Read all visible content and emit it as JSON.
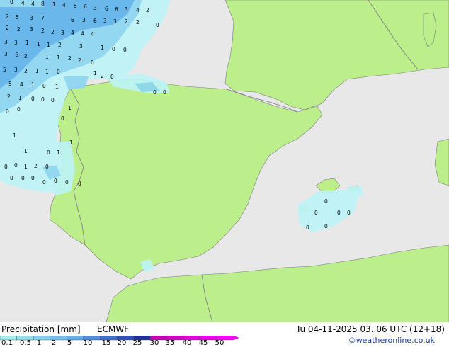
{
  "legend": {
    "title": "Precipitation [mm]",
    "model": "ECMWF",
    "valid": "Tu 04-11-2025 03..06 UTC (12+18)",
    "credit": "©weatheronline.co.uk",
    "ticks": [
      "0.1",
      "0.5",
      "1",
      "2",
      "5",
      "10",
      "15",
      "20",
      "25",
      "30",
      "35",
      "40",
      "45",
      "50"
    ],
    "colors": [
      "#a0f0f0",
      "#90e0f0",
      "#80d0f0",
      "#6fc0f0",
      "#5fb0f0",
      "#4f90e0",
      "#3f70d0",
      "#2f50c0",
      "#1f30a0",
      "#c000c0",
      "#d000d0",
      "#e000e0",
      "#f000f0",
      "#ff00ff"
    ]
  },
  "colors": {
    "sea": "#e8e8e8",
    "land": "#bcee8c",
    "border": "#7a7a7a",
    "precip_light": "#bdf4f8",
    "precip_mid": "#8ad6f2",
    "precip_strong": "#5cb2ec"
  },
  "map_labels": [
    {
      "text": "0"
    },
    {
      "text": "4"
    },
    {
      "text": "4"
    },
    {
      "text": "8"
    },
    {
      "text": "1"
    },
    {
      "text": "4"
    },
    {
      "text": "5"
    },
    {
      "text": "6"
    },
    {
      "text": "3"
    },
    {
      "text": "6"
    },
    {
      "text": "6"
    },
    {
      "text": "3"
    },
    {
      "text": "4"
    },
    {
      "text": "2"
    },
    {
      "text": "2"
    },
    {
      "text": "5"
    },
    {
      "text": "3"
    },
    {
      "text": "7"
    },
    {
      "text": "6"
    },
    {
      "text": "3"
    },
    {
      "text": "6"
    },
    {
      "text": "3"
    },
    {
      "text": "3"
    },
    {
      "text": "2"
    },
    {
      "text": "2"
    },
    {
      "text": "0"
    },
    {
      "text": "2"
    },
    {
      "text": "2"
    },
    {
      "text": "3"
    },
    {
      "text": "2"
    },
    {
      "text": "2"
    },
    {
      "text": "3"
    },
    {
      "text": "4"
    },
    {
      "text": "4"
    },
    {
      "text": "4"
    },
    {
      "text": "3"
    },
    {
      "text": "3"
    },
    {
      "text": "1"
    },
    {
      "text": "1"
    },
    {
      "text": "1"
    },
    {
      "text": "2"
    },
    {
      "text": "3"
    },
    {
      "text": "1"
    },
    {
      "text": "0"
    },
    {
      "text": "0"
    },
    {
      "text": "3"
    },
    {
      "text": "3"
    },
    {
      "text": "2"
    },
    {
      "text": "1"
    },
    {
      "text": "1"
    },
    {
      "text": "2"
    },
    {
      "text": "2"
    },
    {
      "text": "0"
    },
    {
      "text": "5"
    },
    {
      "text": "3"
    },
    {
      "text": "2"
    },
    {
      "text": "1"
    },
    {
      "text": "1"
    },
    {
      "text": "0"
    },
    {
      "text": "1"
    },
    {
      "text": "2"
    },
    {
      "text": "0"
    },
    {
      "text": "5"
    },
    {
      "text": "4"
    },
    {
      "text": "1"
    },
    {
      "text": "0"
    },
    {
      "text": "1"
    },
    {
      "text": "0"
    },
    {
      "text": "0"
    },
    {
      "text": "2"
    },
    {
      "text": "1"
    },
    {
      "text": "0"
    },
    {
      "text": "0"
    },
    {
      "text": "0"
    },
    {
      "text": "0"
    },
    {
      "text": "0"
    },
    {
      "text": "1"
    },
    {
      "text": "0"
    },
    {
      "text": "1"
    },
    {
      "text": "1"
    },
    {
      "text": "1"
    },
    {
      "text": "0"
    },
    {
      "text": "1"
    },
    {
      "text": "0"
    },
    {
      "text": "0"
    },
    {
      "text": "1"
    },
    {
      "text": "2"
    },
    {
      "text": "0"
    },
    {
      "text": "0"
    },
    {
      "text": "0"
    },
    {
      "text": "0"
    },
    {
      "text": "0"
    },
    {
      "text": "0"
    },
    {
      "text": "0"
    },
    {
      "text": "0"
    },
    {
      "text": "0"
    },
    {
      "text": "0"
    },
    {
      "text": "0"
    },
    {
      "text": "0"
    },
    {
      "text": "0"
    },
    {
      "text": "0"
    }
  ]
}
